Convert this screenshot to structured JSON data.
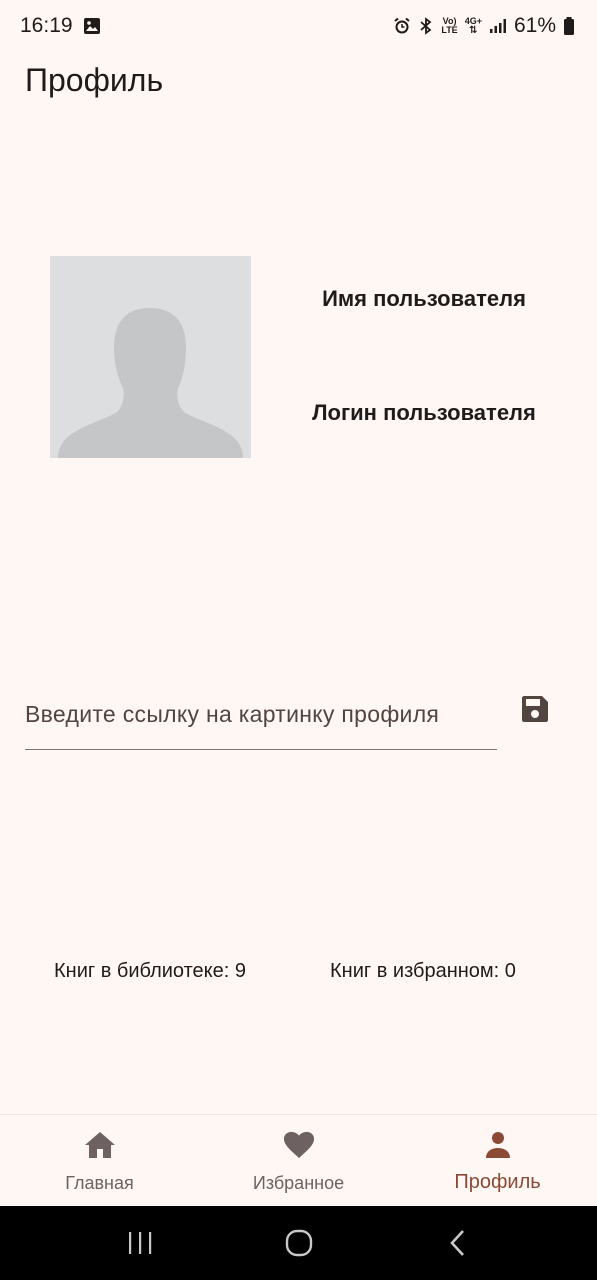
{
  "status_bar": {
    "time": "16:19",
    "lte_top": "Vo)",
    "lte_bottom": "LTE",
    "net_type": "4G+",
    "battery_percent": "61%"
  },
  "app_bar": {
    "title": "Профиль"
  },
  "profile": {
    "user_name": "Имя пользователя",
    "user_login": "Логин пользователя"
  },
  "url_input": {
    "placeholder": "Введите ссылку на картинку профиля"
  },
  "stats": {
    "library": "Книг в библиотеке: 9",
    "favorites": "Книг в избранном: 0"
  },
  "bottom_nav": {
    "items": [
      {
        "label": "Главная",
        "icon": "home-icon",
        "active": false
      },
      {
        "label": "Избранное",
        "icon": "heart-icon",
        "active": false
      },
      {
        "label": "Профиль",
        "icon": "person-icon",
        "active": true
      }
    ]
  },
  "colors": {
    "background": "#fff7f4",
    "accent": "#8a4a35",
    "inactive": "#6d6261",
    "avatar_bg": "#dcdee0"
  }
}
